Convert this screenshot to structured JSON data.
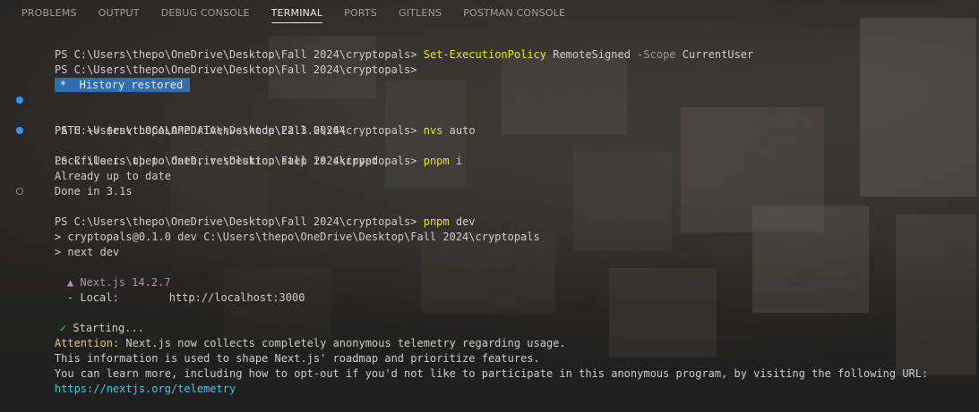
{
  "panel_tabs": [
    {
      "label": "PROBLEMS",
      "active": false
    },
    {
      "label": "OUTPUT",
      "active": false
    },
    {
      "label": "DEBUG CONSOLE",
      "active": false
    },
    {
      "label": "TERMINAL",
      "active": true
    },
    {
      "label": "PORTS",
      "active": false
    },
    {
      "label": "GITLENS",
      "active": false
    },
    {
      "label": "POSTMAN CONSOLE",
      "active": false
    }
  ],
  "terminal": {
    "prompt": "PS C:\\Users\\thepo\\OneDrive\\Desktop\\Fall 2024\\cryptopals>",
    "line1": {
      "cmd": "Set-ExecutionPolicy",
      "arg1": "RemoteSigned",
      "param": "-Scope",
      "arg2": "CurrentUser"
    },
    "history_restored": "History restored",
    "history_star": "*",
    "nvs": {
      "cmd": "nvs",
      "arg": "auto"
    },
    "path_line": "PATH += $env:LOCALAPPDATA\\nvs\\node\\22.3.0\\x64",
    "pnpm_i": {
      "cmd": "pnpm",
      "arg": "i"
    },
    "lockfile_line": "Lockfile is up to date, resolution step is skipped",
    "up_to_date_line": "Already up to date",
    "done_line": "Done in 3.1s",
    "pnpm_dev": {
      "cmd": "pnpm",
      "arg": "dev"
    },
    "script_line1": "> cryptopals@0.1.0 dev C:\\Users\\thepo\\OneDrive\\Desktop\\Fall 2024\\cryptopals",
    "script_line2": "> next dev",
    "next_version": "▲ Next.js 14.2.7",
    "local_label": "- Local:",
    "local_url": "http://localhost:3000",
    "starting_check": "✓",
    "starting": "Starting...",
    "attention_label": "Attention:",
    "attention_text": " Next.js now collects completely anonymous telemetry regarding usage.",
    "info_line": "This information is used to shape Next.js' roadmap and prioritize features.",
    "learn_line": "You can learn more, including how to opt-out if you'd not like to participate in this anonymous program, by visiting the following URL:",
    "telemetry_url": "https://nextjs.org/telemetry"
  },
  "colors": {
    "command": "#e5e510",
    "history_bg": "#2f6db5",
    "gutter_dot": "#3794ff",
    "attention": "#e5c07b",
    "link": "#4ec3d6",
    "success": "#23d18b"
  }
}
